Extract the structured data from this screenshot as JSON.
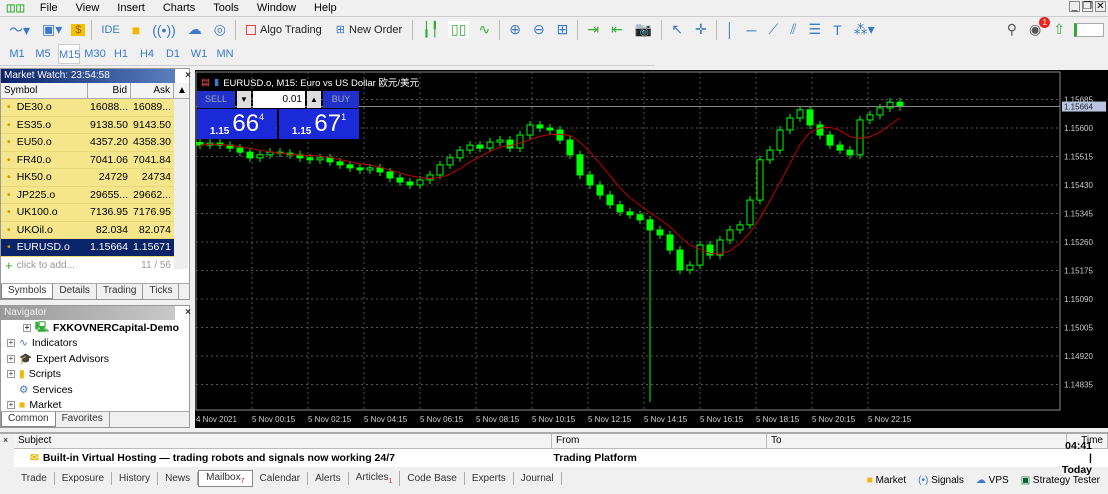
{
  "menu": [
    "File",
    "View",
    "Insert",
    "Charts",
    "Tools",
    "Window",
    "Help"
  ],
  "toolbar": {
    "ide": "IDE",
    "algo_trading": "Algo Trading",
    "new_order": "New Order"
  },
  "timeframes": [
    "M1",
    "M5",
    "M15",
    "M30",
    "H1",
    "H4",
    "D1",
    "W1",
    "MN"
  ],
  "active_timeframe": "M15",
  "notification_count": "1",
  "market_watch": {
    "title": "Market Watch: 23:54:58",
    "headers": [
      "Symbol",
      "Bid",
      "Ask"
    ],
    "rows": [
      {
        "symbol": "DE30.o",
        "bid": "16088...",
        "ask": "16089..."
      },
      {
        "symbol": "ES35.o",
        "bid": "9138.50",
        "ask": "9143.50"
      },
      {
        "symbol": "EU50.o",
        "bid": "4357.20",
        "ask": "4358.30"
      },
      {
        "symbol": "FR40.o",
        "bid": "7041.06",
        "ask": "7041.84"
      },
      {
        "symbol": "HK50.o",
        "bid": "24729",
        "ask": "24734"
      },
      {
        "symbol": "JP225.o",
        "bid": "29655...",
        "ask": "29662..."
      },
      {
        "symbol": "UK100.o",
        "bid": "7136.95",
        "ask": "7176.95"
      },
      {
        "symbol": "UKOil.o",
        "bid": "82.034",
        "ask": "82.074"
      },
      {
        "symbol": "EURUSD.o",
        "bid": "1.15664",
        "ask": "1.15671",
        "selected": true
      }
    ],
    "add_placeholder": "click to add...",
    "count": "11 / 56",
    "tabs": [
      "Symbols",
      "Details",
      "Trading",
      "Ticks"
    ]
  },
  "navigator": {
    "title": "Navigator",
    "items": [
      "FXKOVNERCapital-Demo",
      "Indicators",
      "Expert Advisors",
      "Scripts",
      "Services",
      "Market"
    ],
    "tabs": [
      "Common",
      "Favorites"
    ]
  },
  "chart": {
    "title": "EURUSD.o, M15:  Euro vs US Dollar 欧元/美元",
    "sell_label": "SELL",
    "buy_label": "BUY",
    "volume": "0.01",
    "sell_price": {
      "prefix": "1.15",
      "big": "66",
      "sup": "4"
    },
    "buy_price": {
      "prefix": "1.15",
      "big": "67",
      "sup": "1"
    },
    "current_price": "1.15664",
    "price_ticks": [
      "1.15685",
      "1.15600",
      "1.15515",
      "1.15430",
      "1.15345",
      "1.15260",
      "1.15175",
      "1.15090",
      "1.15005",
      "1.14920",
      "1.14835"
    ],
    "time_ticks": [
      "4 Nov 2021",
      "5 Nov 00:15",
      "5 Nov 02:15",
      "5 Nov 04:15",
      "5 Nov 06:15",
      "5 Nov 08:15",
      "5 Nov 10:15",
      "5 Nov 12:15",
      "5 Nov 14:15",
      "5 Nov 16:15",
      "5 Nov 18:15",
      "5 Nov 20:15",
      "5 Nov 22:15"
    ],
    "candle_color": "#00ff00",
    "ma_color": "#c00000",
    "closes": [
      1.15549,
      1.15555,
      1.15549,
      1.1554,
      1.15528,
      1.15511,
      1.1552,
      1.15528,
      1.15525,
      1.1552,
      1.15511,
      1.15505,
      1.15511,
      1.15499,
      1.1549,
      1.15481,
      1.15475,
      1.15481,
      1.15469,
      1.15451,
      1.15439,
      1.1543,
      1.15445,
      1.1546,
      1.1549,
      1.15511,
      1.15534,
      1.15549,
      1.1554,
      1.15558,
      1.15564,
      1.1554,
      1.15579,
      1.15609,
      1.156,
      1.15594,
      1.15564,
      1.1552,
      1.1546,
      1.1543,
      1.154,
      1.15371,
      1.1535,
      1.15341,
      1.15326,
      1.15296,
      1.15281,
      1.15236,
      1.15177,
      1.15191,
      1.15251,
      1.15221,
      1.15266,
      1.15296,
      1.15311,
      1.15385,
      1.15505,
      1.15534,
      1.15594,
      1.1563,
      1.15654,
      1.15609,
      1.15579,
      1.15549,
      1.15534,
      1.1552,
      1.15624,
      1.15639,
      1.1566,
      1.15677,
      1.15664
    ],
    "spike": {
      "index": 45,
      "low": 1.14783
    }
  },
  "toolbox": {
    "headers": [
      "Subject",
      "From",
      "To",
      "Time"
    ],
    "message": {
      "subject": "Built-in Virtual Hosting — trading robots and signals now working 24/7",
      "from": "Trading Platform",
      "to": "",
      "time": "04:41 | Today"
    },
    "tabs": [
      "Trade",
      "Exposure",
      "History",
      "News",
      "Mailbox",
      "Calendar",
      "Alerts",
      "Articles",
      "Code Base",
      "Experts",
      "Journal"
    ],
    "active_tab": "Mailbox",
    "mailbox_badge": "7",
    "articles_badge": "1",
    "right_links": [
      "Market",
      "Signals",
      "VPS",
      "Strategy Tester"
    ]
  }
}
